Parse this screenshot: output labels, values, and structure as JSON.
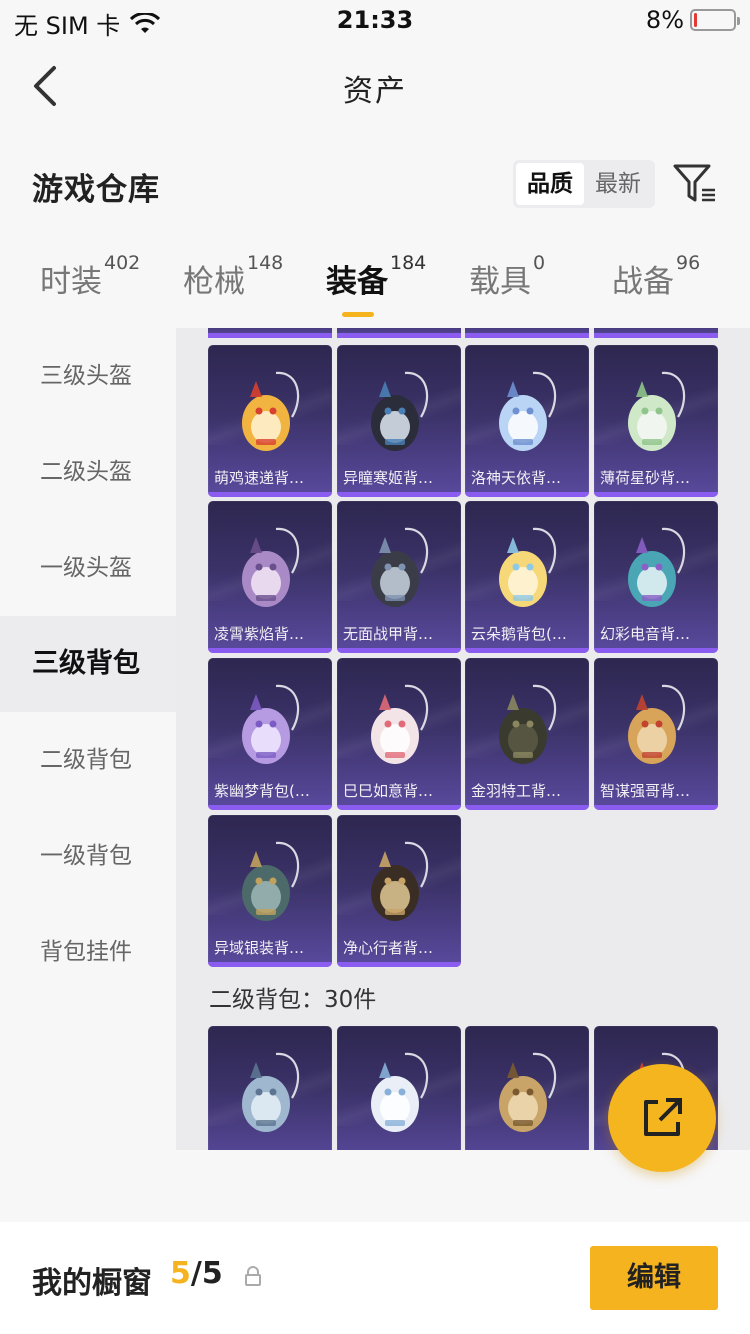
{
  "status_bar": {
    "carrier": "无 SIM 卡",
    "time": "21:33",
    "battery": "8%",
    "battery_level": 0.08,
    "battery_color": "#e53935"
  },
  "nav": {
    "title": "资产"
  },
  "header": {
    "title": "游戏仓库",
    "sort_options": [
      "品质",
      "最新"
    ],
    "sort_active": 0
  },
  "tabs": [
    {
      "label": "时装",
      "count": "402"
    },
    {
      "label": "枪械",
      "count": "148"
    },
    {
      "label": "装备",
      "count": "184",
      "active": true
    },
    {
      "label": "载具",
      "count": "0"
    },
    {
      "label": "战备",
      "count": "96"
    }
  ],
  "sidebar": [
    "三级头盔",
    "二级头盔",
    "一级头盔",
    "三级背包",
    "二级背包",
    "一级背包",
    "背包挂件"
  ],
  "sidebar_active": 3,
  "items": [
    {
      "name": "萌鸡速递背…",
      "icon": "chick-backpack-icon"
    },
    {
      "name": "异瞳寒姬背…",
      "icon": "cat-backpack-icon"
    },
    {
      "name": "洛神天依背…",
      "icon": "winged-backpack-icon"
    },
    {
      "name": "薄荷星砂背…",
      "icon": "mint-backpack-icon"
    },
    {
      "name": "凌霄紫焰背…",
      "icon": "lotus-backpack-icon"
    },
    {
      "name": "无面战甲背…",
      "icon": "armor-backpack-icon"
    },
    {
      "name": "云朵鹅背包(…",
      "icon": "goose-backpack-icon"
    },
    {
      "name": "幻彩电音背…",
      "icon": "speaker-backpack-icon"
    },
    {
      "name": "紫幽梦背包(…",
      "icon": "purple-backpack-icon"
    },
    {
      "name": "巳巳如意背…",
      "icon": "snake-backpack-icon"
    },
    {
      "name": "金羽特工背…",
      "icon": "tactical-backpack-icon"
    },
    {
      "name": "智谋强哥背…",
      "icon": "mushroom-backpack-icon"
    },
    {
      "name": "异域银装背…",
      "icon": "silver-backpack-icon"
    },
    {
      "name": "净心行者背…",
      "icon": "gourd-backpack-icon"
    }
  ],
  "group_label": "二级背包：30件",
  "group_items": [
    {
      "icon": "sword-backpack-icon"
    },
    {
      "icon": "pouch-backpack-icon"
    },
    {
      "icon": "bear-backpack-icon"
    },
    {
      "icon": "toy-backpack-icon"
    }
  ],
  "bottom": {
    "title": "我的橱窗",
    "current": "5",
    "separator": "/",
    "total": "5",
    "edit_label": "编辑"
  },
  "colors": {
    "accent": "#f5b320",
    "card_bottom": "#8a5cf0"
  }
}
